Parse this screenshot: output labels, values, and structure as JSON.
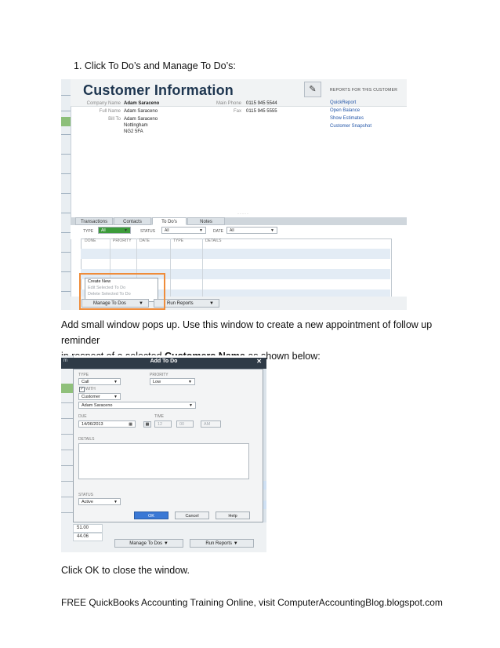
{
  "doc": {
    "step1": "1.   Click To Do’s and Manage To Do’s:",
    "para1_line1": "Add small window pops up. Use this window to create a new appointment of follow up reminder",
    "para1_line2_pre": "in respect of a selected ",
    "para1_line2_bold": "Customers Name",
    "para1_line2_post": " as shown below:",
    "para2": "Click OK to close the window.",
    "footer": "FREE QuickBooks Accounting Training Online, visit ComputerAccountingBlog.blogspot.com"
  },
  "shot1": {
    "title": "Customer Information",
    "edit_icon": "pencil-icon",
    "reports_header": "REPORTS FOR THIS CUSTOMER",
    "report_links": [
      "QuickReport",
      "Open Balance",
      "Show Estimates",
      "Customer Snapshot"
    ],
    "fields": {
      "company_label": "Company Name",
      "company_value": "Adam Saraceno",
      "full_label": "Full Name",
      "full_value": "Adam  Saraceno",
      "bill_label": "Bill To",
      "bill_lines": [
        "Adam Saraceno",
        "Nottingham",
        "NG2 5FA"
      ],
      "phone_label": "Main Phone",
      "phone_value": "0115 945 5544",
      "fax_label": "Fax",
      "fax_value": "0115 945 5555"
    },
    "tabs": [
      "Transactions",
      "Contacts",
      "To Do's",
      "Notes"
    ],
    "active_tab": "To Do's",
    "filters": {
      "type_label": "TYPE",
      "type_value": "All",
      "status_label": "STATUS",
      "status_value": "All",
      "date_label": "DATE",
      "date_value": "All"
    },
    "columns": [
      "DONE",
      "PRIORITY",
      "DATE",
      "TYPE",
      "DETAILS"
    ],
    "menu_items": [
      "Create New",
      "Edit Selected To Do",
      "Delete Selected To Do"
    ],
    "manage_button": "Manage To Dos",
    "run_reports_button": "Run Reports",
    "highlight_color": "#ef8c3a"
  },
  "shot2": {
    "dialog_title": "Add To Do",
    "titlebar_left": "m",
    "close_icon": "close-icon",
    "type_label": "TYPE",
    "type_value": "Call",
    "priority_label": "PRIORITY",
    "priority_value": "Low",
    "with_label": "WITH",
    "with_value": "Customer",
    "customer_value": "Adam Saraceno",
    "due_label": "DUE",
    "due_value": "14/06/2013",
    "time_label": "TIME",
    "time_hour": "12",
    "time_min": "00",
    "time_ampm": "AM",
    "details_label": "DETAILS",
    "status_label": "STATUS",
    "status_value": "Active",
    "ok_button": "OK",
    "cancel_button": "Cancel",
    "help_button": "Help",
    "amounts": [
      "51.00",
      "44.06"
    ],
    "manage_button": "Manage To Dos",
    "run_reports_button": "Run Reports",
    "primary_color": "#3a78d5"
  }
}
